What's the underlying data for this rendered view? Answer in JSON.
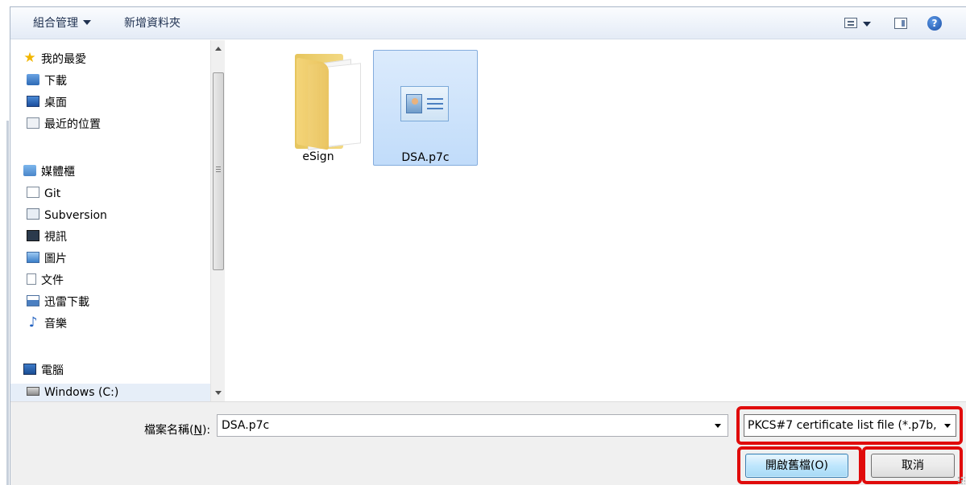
{
  "toolbar": {
    "organize_label": "組合管理",
    "new_folder_label": "新增資料夾",
    "view_icon": "view-options-icon",
    "preview_pane_icon": "preview-pane-icon",
    "help_icon": "help-icon",
    "help_glyph": "?"
  },
  "nav": {
    "favorites": {
      "label": "我的最愛",
      "icon": "star-icon",
      "items": [
        {
          "label": "下載",
          "icon": "downloads-folder-icon"
        },
        {
          "label": "桌面",
          "icon": "desktop-icon"
        },
        {
          "label": "最近的位置",
          "icon": "recent-places-icon"
        }
      ]
    },
    "libraries": {
      "label": "媒體櫃",
      "icon": "library-icon",
      "items": [
        {
          "label": "Git",
          "icon": "git-library-icon"
        },
        {
          "label": "Subversion",
          "icon": "subversion-library-icon"
        },
        {
          "label": "視訊",
          "icon": "video-library-icon"
        },
        {
          "label": "圖片",
          "icon": "pictures-library-icon"
        },
        {
          "label": "文件",
          "icon": "documents-library-icon"
        },
        {
          "label": "迅雷下載",
          "icon": "xunlei-downloads-icon"
        },
        {
          "label": "音樂",
          "icon": "music-library-icon"
        }
      ]
    },
    "computer": {
      "label": "電腦",
      "icon": "computer-icon",
      "items": [
        {
          "label": "Windows  (C:)",
          "icon": "windows-drive-icon"
        }
      ]
    }
  },
  "files": [
    {
      "name": "eSign",
      "type": "folder",
      "icon": "folder-icon",
      "selected": false
    },
    {
      "name": "DSA.p7c",
      "type": "certificate",
      "icon": "certificate-file-icon",
      "selected": true
    }
  ],
  "bottom": {
    "filename_label_prefix": "檔案名稱(",
    "filename_label_key": "N",
    "filename_label_suffix": "):",
    "filename_value": "DSA.p7c",
    "filetype_value": "PKCS#7 certificate list file (*.p7b,",
    "open_button_label": "開啟舊檔(O)",
    "cancel_button_label": "取消"
  },
  "colors": {
    "highlight_red": "#e00b0b",
    "selection_blue": "#c1dcfa",
    "toolbar_text": "#1e3050"
  }
}
